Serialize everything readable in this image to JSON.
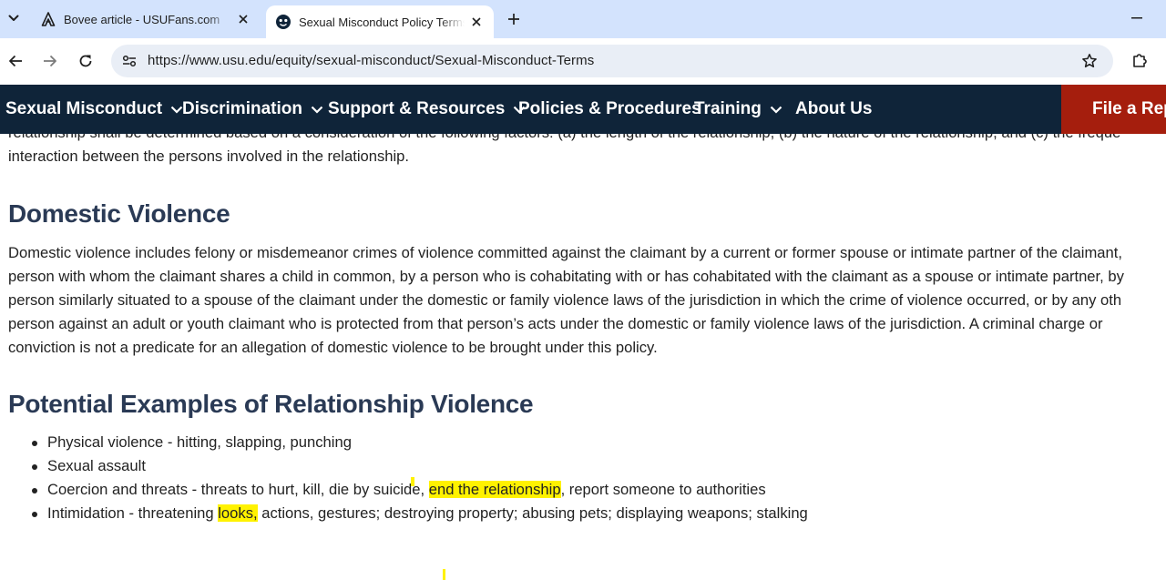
{
  "browser": {
    "tabs": [
      {
        "title": "Bovee article - USUFans.com",
        "active": false,
        "favicon": "usu-a-icon"
      },
      {
        "title": "Sexual Misconduct Policy Terms",
        "active": true,
        "favicon": "usu-aggie-icon"
      }
    ],
    "url": "https://www.usu.edu/equity/sexual-misconduct/Sexual-Misconduct-Terms"
  },
  "site_nav": {
    "items": [
      {
        "label": "Sexual Misconduct",
        "has_dropdown": true
      },
      {
        "label": "Discrimination",
        "has_dropdown": true
      },
      {
        "label": "Support & Resources",
        "has_dropdown": true
      },
      {
        "label": "Policies & Procedures",
        "has_dropdown": false
      },
      {
        "label": "Training",
        "has_dropdown": true
      },
      {
        "label": "About Us",
        "has_dropdown": false
      }
    ],
    "report_button": "File a Repo",
    "colors": {
      "nav_bg": "#0f2439",
      "report_bg": "#a51e0d"
    }
  },
  "content": {
    "intro_cutoff": "relationship shall be determined based on a consideration of the following factors: (a) the length of the relationship, (b) the nature of the relationship, and (c) the freque",
    "intro_last": "interaction between the persons involved in the relationship.",
    "domestic_heading": "Domestic Violence",
    "domestic_lines": [
      "Domestic violence includes felony or misdemeanor crimes of violence committed against the claimant by a current or former spouse or intimate partner of the claimant,",
      "person with whom the claimant shares a child in common, by a person who is cohabitating with or has cohabitated with the claimant as a spouse or intimate partner, by",
      "person similarly situated to a spouse of the claimant under the domestic or family violence laws of the jurisdiction in which the crime of violence occurred, or by any oth",
      "person against an adult or youth claimant who is protected from that person’s acts under the domestic or family violence laws of the jurisdiction. A criminal charge or",
      "conviction is not a predicate for an allegation of domestic violence to be brought under this policy."
    ],
    "examples_heading": "Potential Examples of Relationship Violence",
    "examples": [
      {
        "text": "Physical violence - hitting, slapping, punching"
      },
      {
        "text": "Sexual assault"
      },
      {
        "pre": "Coercion and threats - threats to hurt, kill, die by suicide, ",
        "highlight": "end the relationship",
        "post": ", report someone to authorities"
      },
      {
        "pre": "Intimidation - threatening ",
        "highlight": "looks,",
        "post": " actions, gestures; destroying property; abusing pets; displaying weapons; stalking"
      }
    ],
    "highlight_color": "#fff200"
  }
}
